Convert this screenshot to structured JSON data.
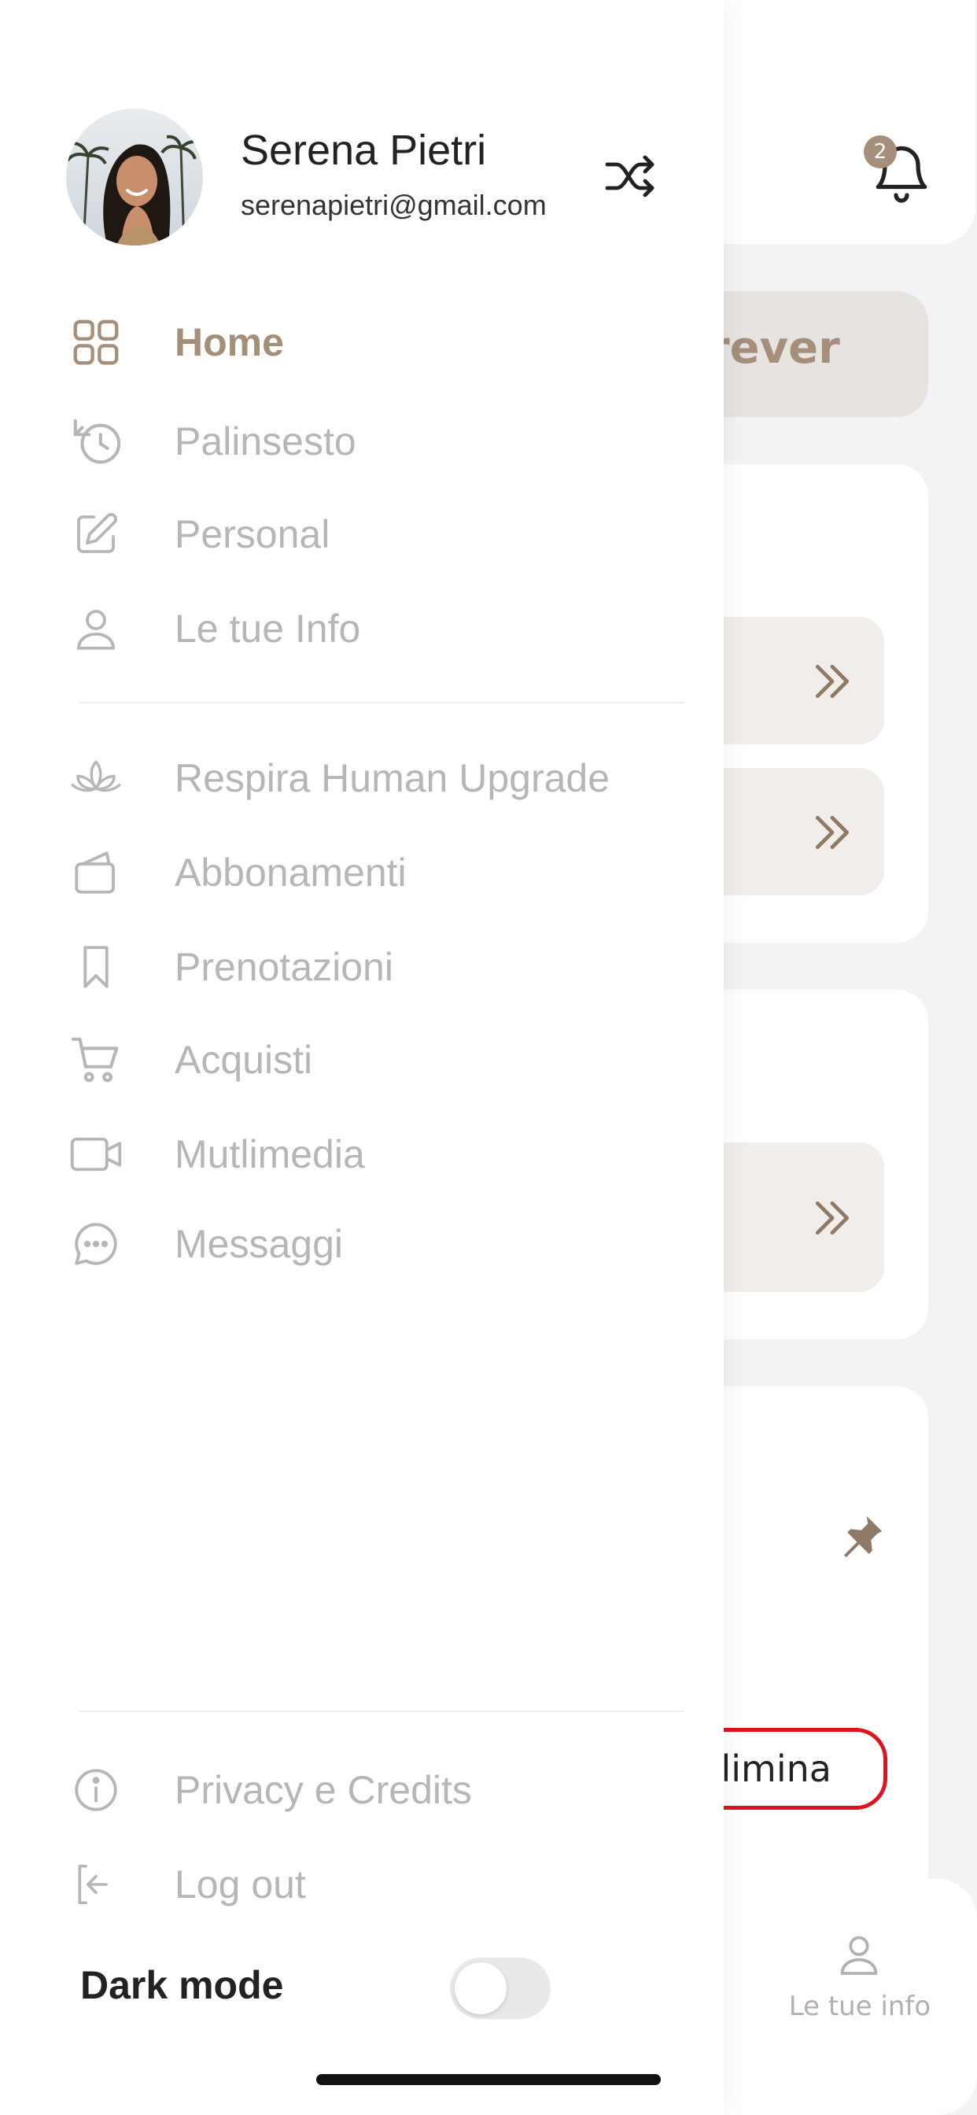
{
  "background": {
    "notifications_count": "2",
    "pill_text": "rever",
    "delete_button_label": "limina",
    "tabbar": {
      "active_tab_label": "Le tue info"
    }
  },
  "drawer": {
    "user": {
      "name": "Serena Pietri",
      "email": "serenapietri@gmail.com"
    },
    "nav_primary": [
      {
        "label": "Home",
        "icon": "grid-icon",
        "active": true
      },
      {
        "label": "Palinsesto",
        "icon": "history-icon"
      },
      {
        "label": "Personal",
        "icon": "edit-icon"
      },
      {
        "label": "Le tue Info",
        "icon": "user-icon"
      }
    ],
    "nav_secondary": [
      {
        "label": "Respira Human Upgrade",
        "icon": "lotus-icon"
      },
      {
        "label": "Abbonamenti",
        "icon": "wallet-icon"
      },
      {
        "label": "Prenotazioni",
        "icon": "bookmark-icon"
      },
      {
        "label": "Acquisti",
        "icon": "cart-icon"
      },
      {
        "label": "Mutlimedia",
        "icon": "video-icon"
      },
      {
        "label": "Messaggi",
        "icon": "chat-icon"
      }
    ],
    "nav_footer": [
      {
        "label": "Privacy e Credits",
        "icon": "info-icon"
      },
      {
        "label": "Log out",
        "icon": "logout-icon"
      }
    ],
    "dark_mode": {
      "label": "Dark mode",
      "enabled": false
    }
  },
  "colors": {
    "accent": "#a58f7b",
    "inactive_text": "#b8b6b4",
    "danger": "#e0121c"
  }
}
